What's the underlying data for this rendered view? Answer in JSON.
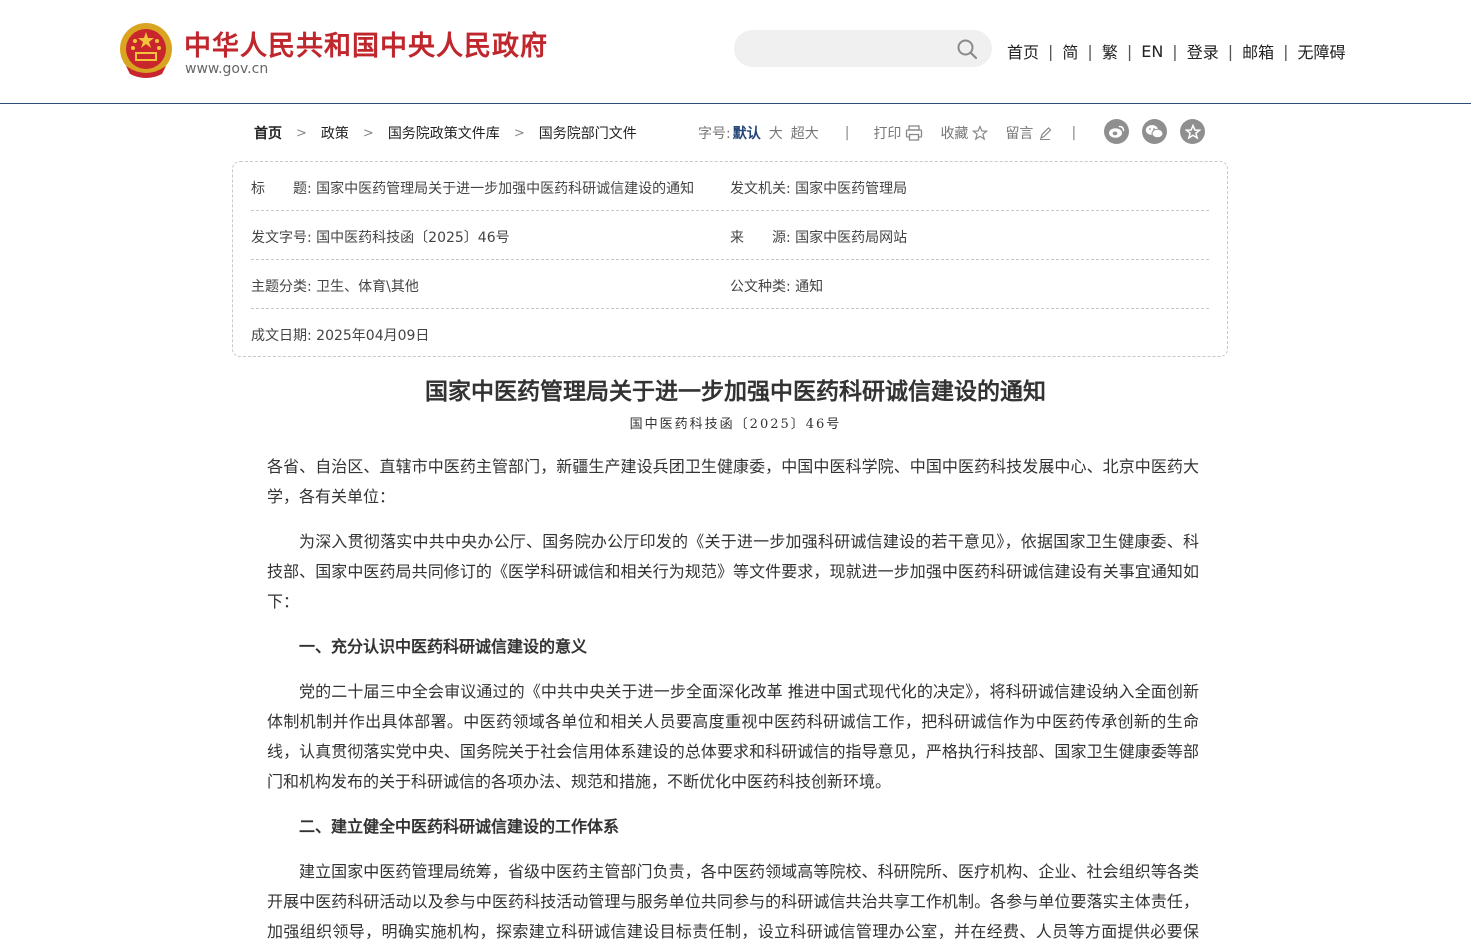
{
  "header": {
    "site_name": "中华人民共和国中央人民政府",
    "site_url": "www.gov.cn",
    "search_placeholder": "",
    "nav": [
      "首页",
      "简",
      "繁",
      "EN",
      "登录",
      "邮箱",
      "无障碍"
    ],
    "nav_sep": "|"
  },
  "breadcrumb": {
    "items": [
      "首页",
      "政策",
      "国务院政策文件库",
      "国务院部门文件"
    ],
    "arrow": ">"
  },
  "toolbar": {
    "font_size_label": "字号:",
    "font_default": "默认",
    "font_large": "大",
    "font_xlarge": "超大",
    "divider": "|",
    "print": "打印",
    "favorite": "收藏",
    "comment": "留言"
  },
  "share": [
    "weibo-icon",
    "wechat-icon",
    "star-icon"
  ],
  "info": {
    "title_label": "标　　题:",
    "title_value": "国家中医药管理局关于进一步加强中医药科研诚信建设的通知",
    "issuer_label": "发文机关:",
    "issuer_value": "国家中医药管理局",
    "docno_label": "发文字号:",
    "docno_value": "国中医药科技函〔2025〕46号",
    "source_label": "来　　源:",
    "source_value": "国家中医药局网站",
    "topic_label": "主题分类:",
    "topic_value": "卫生、体育\\其他",
    "type_label": "公文种类:",
    "type_value": "通知",
    "date_label": "成文日期:",
    "date_value": "2025年04月09日"
  },
  "article": {
    "title": "国家中医药管理局关于进一步加强中医药科研诚信建设的通知",
    "doc_number": "国中医药科技函〔2025〕46号",
    "recipients": "各省、自治区、直辖市中医药主管部门，新疆生产建设兵团卫生健康委，中国中医科学院、中国中医药科技发展中心、北京中医药大学，各有关单位：",
    "intro": "为深入贯彻落实中共中央办公厅、国务院办公厅印发的《关于进一步加强科研诚信建设的若干意见》，依据国家卫生健康委、科技部、国家中医药局共同修订的《医学科研诚信和相关行为规范》等文件要求，现就进一步加强中医药科研诚信建设有关事宜通知如下：",
    "h1": "一、充分认识中医药科研诚信建设的意义",
    "p1": "党的二十届三中全会审议通过的《中共中央关于进一步全面深化改革 推进中国式现代化的决定》，将科研诚信建设纳入全面创新体制机制并作出具体部署。中医药领域各单位和相关人员要高度重视中医药科研诚信工作，把科研诚信作为中医药传承创新的生命线，认真贯彻落实党中央、国务院关于社会信用体系建设的总体要求和科研诚信的指导意见，严格执行科技部、国家卫生健康委等部门和机构发布的关于科研诚信的各项办法、规范和措施，不断优化中医药科技创新环境。",
    "h2": "二、建立健全中医药科研诚信建设的工作体系",
    "p2": "建立国家中医药管理局统筹，省级中医药主管部门负责，各中医药领域高等院校、科研院所、医疗机构、企业、社会组织等各类开展中医药科研活动以及参与中医药科技活动管理与服务单位共同参与的科研诚信共治共享工作机制。各参与单位要落实主体责任，加强组织领导，明确实施机构，探索建立科研诚信建设目标责任制，设立科研诚信管理办公室，并在经费、人员等方面提供必要保障。"
  }
}
